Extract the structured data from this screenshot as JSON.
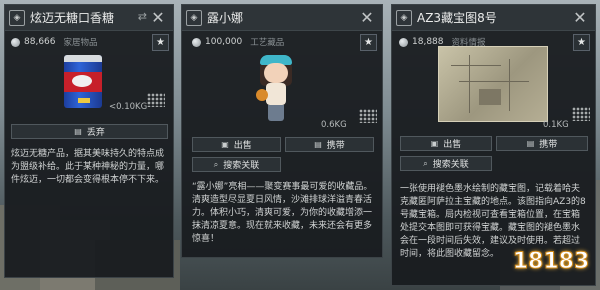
{
  "panel1": {
    "title": "炫迈无糖口香糖",
    "price": "88,666",
    "category": "家居物品",
    "weight": "<0.10KG",
    "action_button": "丢弃",
    "description": "炫迈无糖产品，据其美味持久的特点成为盟级补给。此于某种神秘的力量，哪件炫迈，一切都会变得根本停不下来。"
  },
  "panel2": {
    "title": "露小娜",
    "price": "100,000",
    "category": "工艺藏品",
    "weight": "0.6KG",
    "sell_button": "出售",
    "carry_button": "携带",
    "search_button": "搜索关联",
    "description": "“露小娜”亮相——聚变赛事最可爱的收藏品。清爽造型尽显夏日风情，沙滩排球洋溢青春活力。体积小巧，清爽可爱，为你的收藏增添一抹清凉夏意。现在就来收藏，未来还会有更多惊喜！"
  },
  "panel3": {
    "title": "AZ3藏宝图8号",
    "price": "18,888",
    "category": "资料情报",
    "weight": "0.1KG",
    "sell_button": "出售",
    "carry_button": "携带",
    "search_button": "搜索关联",
    "description": "一张使用褪色墨水绘制的藏宝图，记载着哈夫克藏匿阿萨拉主宝藏的地点。该图指向AZ3的8号藏宝箱。局内检视可查看宝箱位置，在宝箱处提交本图即可获得宝藏。藏宝图的褪色墨水会在一段时间后失效，建议及时使用。若超过时间，将此图收藏留念。"
  },
  "watermark": "18183",
  "icons": {
    "coin": "coin-icon",
    "star": "star-icon",
    "close": "close-icon",
    "grid": "weight-grid-icon"
  }
}
